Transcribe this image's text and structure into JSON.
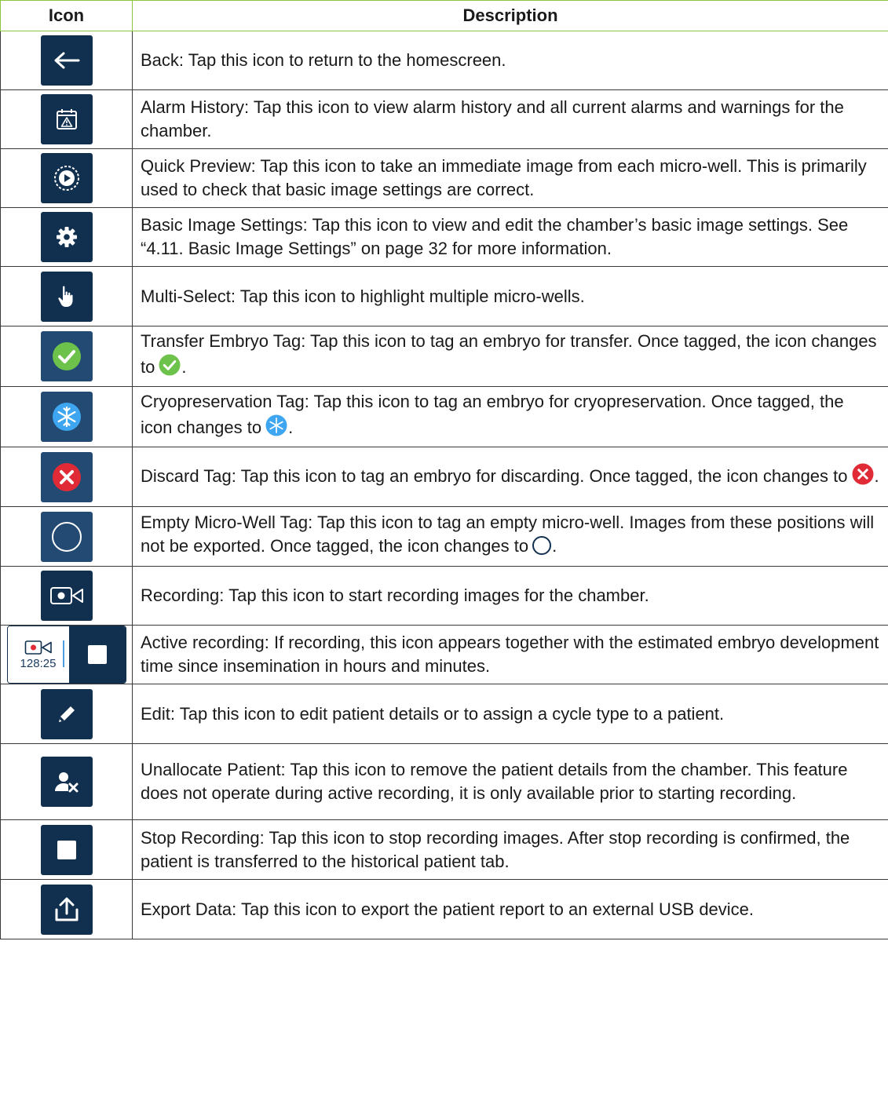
{
  "header": {
    "col_icon": "Icon",
    "col_description": "Description"
  },
  "rows": [
    {
      "icon": "back-arrow-icon",
      "desc_1": "Back: Tap this icon to return to the homescreen."
    },
    {
      "icon": "alarm-history-icon",
      "desc_1": "Alarm History: Tap this icon to view alarm history and all current alarms and warnings for the chamber."
    },
    {
      "icon": "quick-preview-icon",
      "desc_1": "Quick Preview: Tap this icon to take an immediate image from each micro-well. This is primarily used to check that basic image settings are correct."
    },
    {
      "icon": "gear-icon",
      "desc_1": "Basic Image Settings: Tap this icon to view and edit the chamber’s basic image settings. See “4.11. Basic Image Settings” on page 32 for more information."
    },
    {
      "icon": "hand-pointer-icon",
      "desc_1": "Multi-Select: Tap this icon to highlight multiple micro-wells."
    },
    {
      "icon": "check-circle-icon",
      "desc_1": "Transfer Embryo Tag: Tap this icon to tag an embryo for transfer. Once tagged, the icon changes to",
      "desc_2": "."
    },
    {
      "icon": "snowflake-icon",
      "desc_1": "Cryopreservation Tag: Tap this icon to tag an embryo for cryopreservation. Once tagged, the icon changes to",
      "desc_2": "."
    },
    {
      "icon": "x-circle-icon",
      "desc_1": "Discard Tag: Tap this icon to tag an embryo for discarding. Once tagged, the icon changes to",
      "desc_2": "."
    },
    {
      "icon": "empty-circle-icon",
      "desc_1": "Empty Micro-Well Tag: Tap this icon to tag an empty micro-well. Images from these positions will not be exported. Once tagged, the icon changes to",
      "desc_2": "."
    },
    {
      "icon": "video-camera-icon",
      "desc_1": "Recording: Tap this icon to start recording images for the chamber."
    },
    {
      "icon": "active-recording-icon",
      "time": "128:25",
      "desc_1": "Active recording: If recording, this icon appears together with the estimated embryo development time since insemination in hours and minutes."
    },
    {
      "icon": "pencil-icon",
      "desc_1": "Edit: Tap this icon to edit patient details or to assign a cycle type to a patient."
    },
    {
      "icon": "user-remove-icon",
      "desc_1": "Unallocate Patient: Tap this icon to remove the patient details from the chamber. This feature does not operate during active recording, it is only available prior to starting recording."
    },
    {
      "icon": "stop-square-icon",
      "desc_1": "Stop Recording: Tap this icon to stop recording images. After stop recording is confirmed, the patient is transferred to the historical patient tab."
    },
    {
      "icon": "export-upload-icon",
      "desc_1": "Export Data: Tap this icon to export the patient report to an external USB device."
    }
  ],
  "colors": {
    "header_border": "#8cc63f",
    "icon_bg": "#11304f",
    "check": "#6cc24a",
    "snow": "#3ea6f0",
    "discard": "#e02a36"
  }
}
